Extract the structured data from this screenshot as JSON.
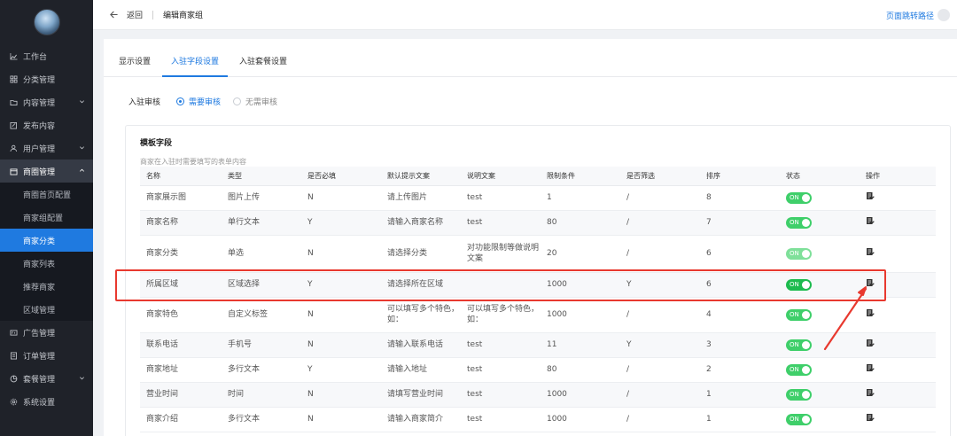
{
  "sidebar": {
    "items": [
      {
        "label": "工作台",
        "icon": "chart-line-icon",
        "chevron": false
      },
      {
        "label": "分类管理",
        "icon": "grid-icon",
        "chevron": false
      },
      {
        "label": "内容管理",
        "icon": "folder-icon",
        "chevron": true
      },
      {
        "label": "发布内容",
        "icon": "edit-square-icon",
        "chevron": false
      },
      {
        "label": "用户管理",
        "icon": "user-icon",
        "chevron": true
      },
      {
        "label": "商圈管理",
        "icon": "store-icon",
        "chevron": true,
        "open": true
      }
    ],
    "submenu": [
      {
        "label": "商圈首页配置"
      },
      {
        "label": "商家组配置"
      },
      {
        "label": "商家分类",
        "active": true
      },
      {
        "label": "商家列表"
      },
      {
        "label": "推荐商家"
      },
      {
        "label": "区域管理"
      }
    ],
    "items_after": [
      {
        "label": "广告管理",
        "icon": "ad-icon",
        "chevron": false
      },
      {
        "label": "订单管理",
        "icon": "order-icon",
        "chevron": false
      },
      {
        "label": "套餐管理",
        "icon": "package-icon",
        "chevron": true
      },
      {
        "label": "系统设置",
        "icon": "settings-icon",
        "chevron": false
      }
    ]
  },
  "topbar": {
    "back_label": "返回",
    "title": "编辑商家组",
    "right_link": "页面跳转路径"
  },
  "tabs": [
    {
      "label": "显示设置",
      "active": false
    },
    {
      "label": "入驻字段设置",
      "active": true
    },
    {
      "label": "入驻套餐设置",
      "active": false
    }
  ],
  "review": {
    "label": "入驻审核",
    "options": [
      {
        "label": "需要审核",
        "checked": true
      },
      {
        "label": "无需审核",
        "checked": false
      }
    ]
  },
  "card": {
    "title": "模板字段",
    "desc": "商家在入驻时需要填写的表单内容"
  },
  "table": {
    "headers": [
      "名称",
      "类型",
      "是否必填",
      "默认提示文案",
      "说明文案",
      "限制条件",
      "是否筛选",
      "排序",
      "状态",
      "操作"
    ],
    "toggle_label": "ON",
    "rows": [
      [
        "商家展示图",
        "图片上传",
        "N",
        "请上传图片",
        "test",
        "1",
        "/",
        "8"
      ],
      [
        "商家名称",
        "单行文本",
        "Y",
        "请输入商家名称",
        "test",
        "80",
        "/",
        "7"
      ],
      [
        "商家分类",
        "单选",
        "N",
        "请选择分类",
        "对功能限制等做说明文案",
        "20",
        "/",
        "6"
      ],
      [
        "所属区域",
        "区域选择",
        "Y",
        "请选择所在区域",
        "",
        "1000",
        "Y",
        "6"
      ],
      [
        "商家特色",
        "自定义标签",
        "N",
        "可以填写多个特色，如：",
        "可以填写多个特色，如：",
        "1000",
        "/",
        "4"
      ],
      [
        "联系电话",
        "手机号",
        "N",
        "请输入联系电话",
        "test",
        "11",
        "Y",
        "3"
      ],
      [
        "商家地址",
        "多行文本",
        "Y",
        "请输入地址",
        "test",
        "80",
        "/",
        "2"
      ],
      [
        "营业时间",
        "时间",
        "N",
        "请填写营业时间",
        "test",
        "1000",
        "/",
        "1"
      ],
      [
        "商家介绍",
        "多行文本",
        "N",
        "请输入商家简介",
        "test",
        "1000",
        "/",
        "1"
      ]
    ]
  },
  "colors": {
    "primary": "#1f7ae0",
    "sidebar_bg": "#1f2229",
    "toggle_on": "#3fcf6a",
    "annotation": "#e8392f"
  }
}
